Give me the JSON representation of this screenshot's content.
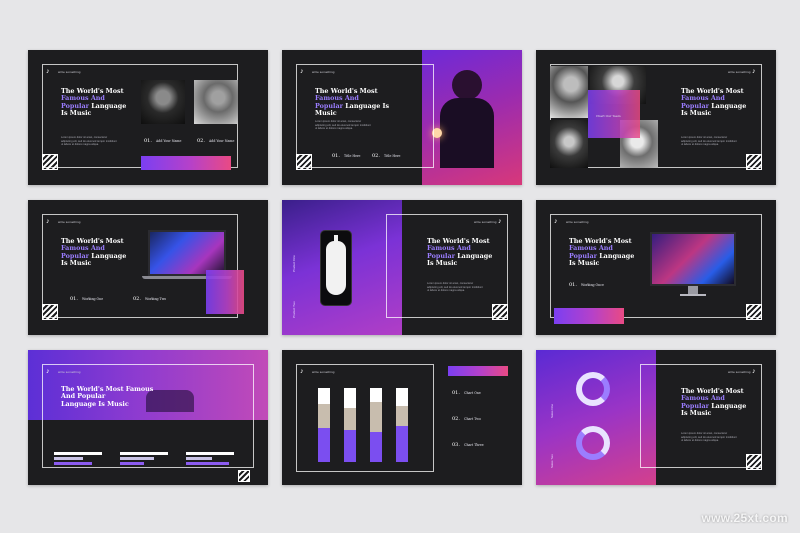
{
  "colors": {
    "background": "#e6e6e8",
    "slide": "#1d1d1f",
    "accent_purple": "#7b3ff2",
    "accent_pink": "#e94a84",
    "highlight_text": "#9b7dff"
  },
  "common": {
    "tag": "write something",
    "note_icon": "music-note-icon",
    "title_plain_1": "The World's Most",
    "title_hl_1": "Famous And",
    "title_hl_2": "Popular",
    "title_plain_2": "Language",
    "title_plain_3": "Is Music",
    "body_text": "Lorem ipsum dolor sit amet, consectetur adipiscing elit, sed do eiusmod tempor incididunt ut labore et dolore magna aliqua."
  },
  "slide1": {
    "num1": "01.",
    "label1": "Add Your Name",
    "num2": "02.",
    "label2": "Add Your Name"
  },
  "slide2": {
    "num1": "01.",
    "label1": "Title Here",
    "num2": "02.",
    "label2": "Title Here"
  },
  "slide3": {
    "overlay_label": "Chart Our Team"
  },
  "slide4": {
    "num1": "01.",
    "label1": "Working One",
    "num2": "02.",
    "label2": "Working Two"
  },
  "slide5": {
    "side_labels": [
      "Product One",
      "Product Two"
    ]
  },
  "slide6": {
    "num1": "01.",
    "label1": "Working Once"
  },
  "slide7": {
    "title_line1": "The World's Most Famous",
    "title_line2": "And Popular",
    "title_line3": "Language Is Music"
  },
  "slide8": {
    "items": [
      {
        "num": "01.",
        "label": "Chart One"
      },
      {
        "num": "02.",
        "label": "Chart Two"
      },
      {
        "num": "03.",
        "label": "Chart Three"
      }
    ]
  },
  "slide9": {
    "side_labels": [
      "Sales One",
      "Sales Two"
    ]
  },
  "watermark": "www.25xt.com"
}
